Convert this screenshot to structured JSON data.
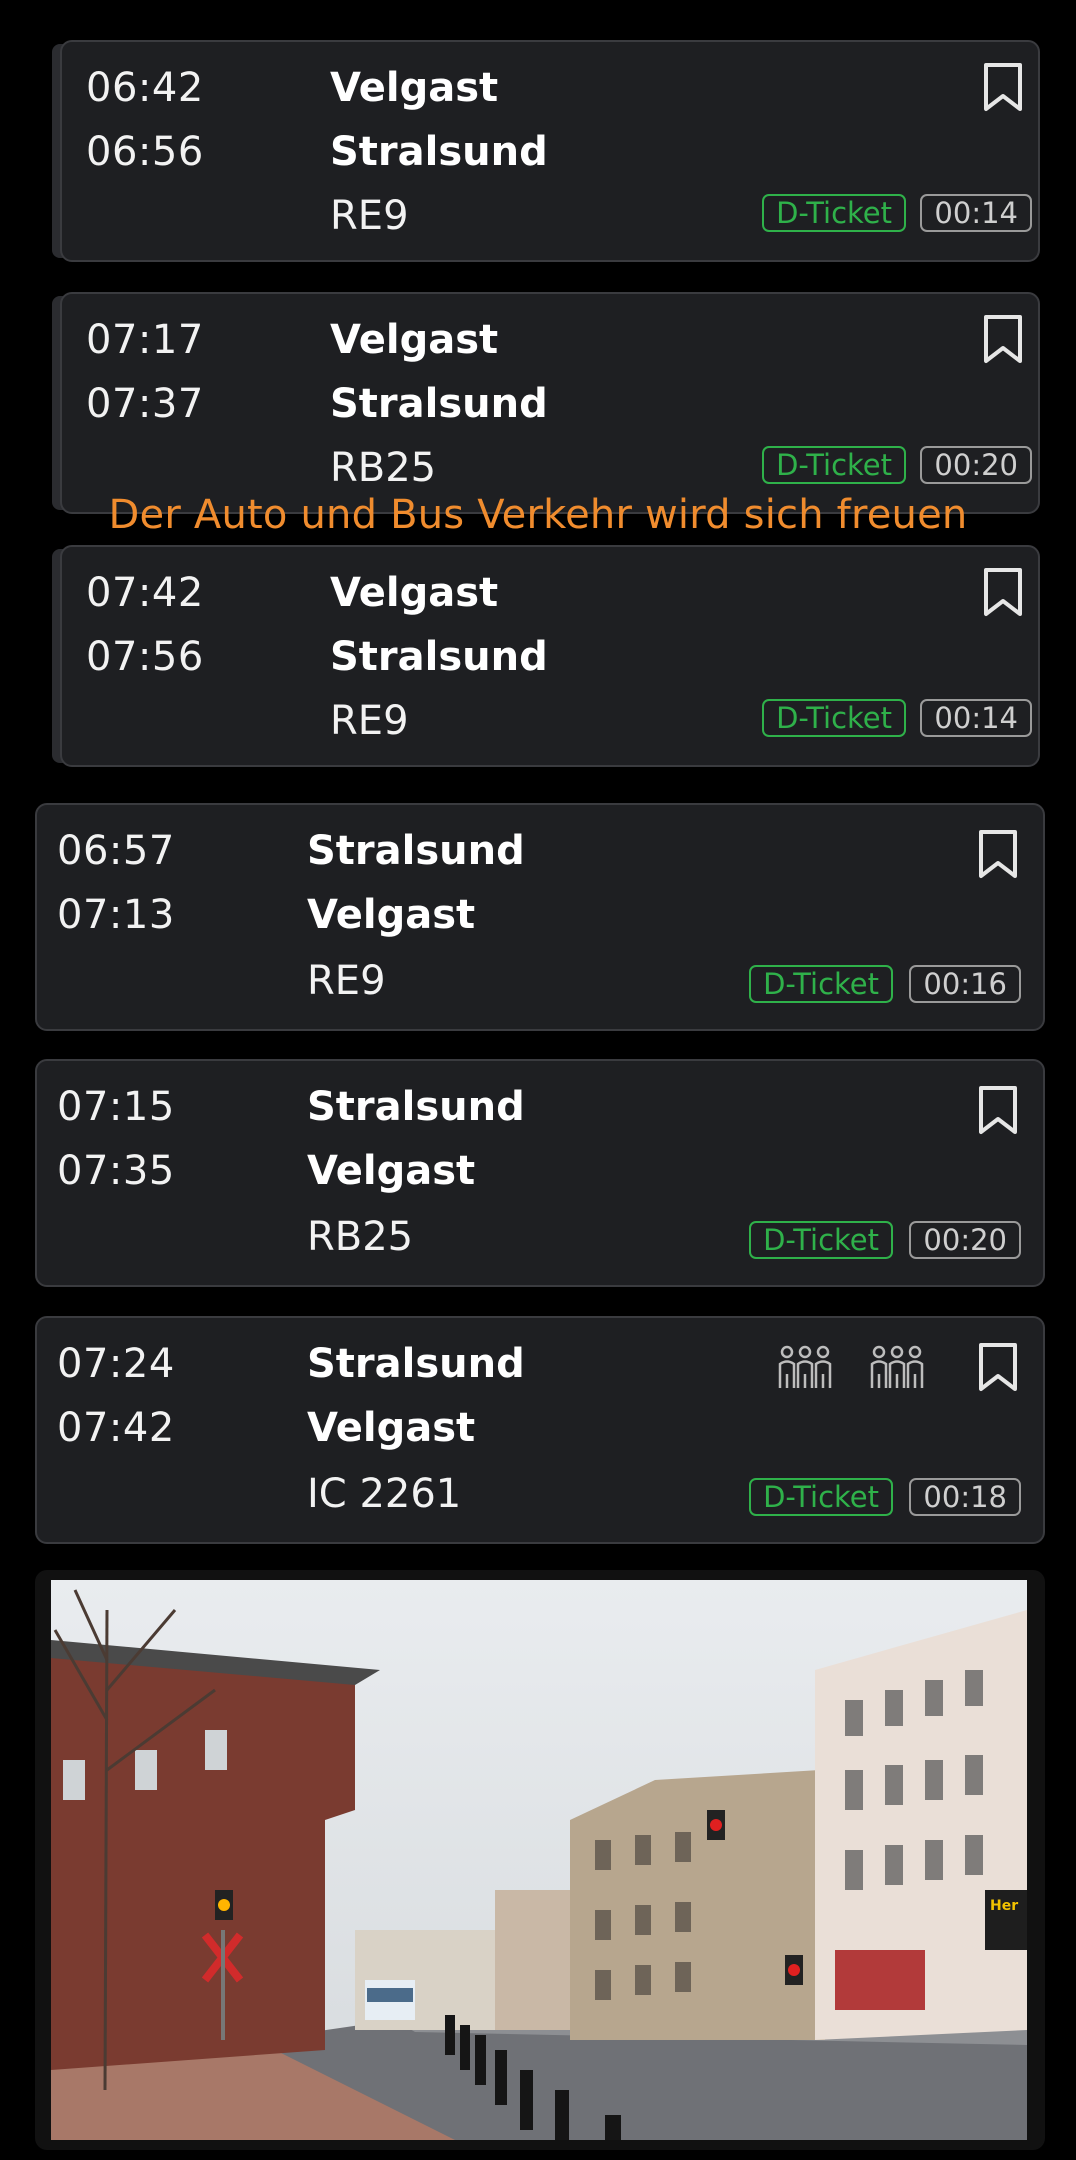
{
  "caption": "Der Auto und Bus Verkehr wird sich freuen",
  "connections": [
    {
      "dep": "06:42",
      "arr": "06:56",
      "from": "Velgast",
      "to": "Stralsund",
      "line": "RE9",
      "ticket": "D-Ticket",
      "duration": "00:14"
    },
    {
      "dep": "07:17",
      "arr": "07:37",
      "from": "Velgast",
      "to": "Stralsund",
      "line": "RB25",
      "ticket": "D-Ticket",
      "duration": "00:20"
    },
    {
      "dep": "07:42",
      "arr": "07:56",
      "from": "Velgast",
      "to": "Stralsund",
      "line": "RE9",
      "ticket": "D-Ticket",
      "duration": "00:14"
    },
    {
      "dep": "06:57",
      "arr": "07:13",
      "from": "Stralsund",
      "to": "Velgast",
      "line": "RE9",
      "ticket": "D-Ticket",
      "duration": "00:16"
    },
    {
      "dep": "07:15",
      "arr": "07:35",
      "from": "Stralsund",
      "to": "Velgast",
      "line": "RB25",
      "ticket": "D-Ticket",
      "duration": "00:20"
    },
    {
      "dep": "07:24",
      "arr": "07:42",
      "from": "Stralsund",
      "to": "Velgast",
      "line": "IC 2261",
      "ticket": "D-Ticket",
      "duration": "00:18",
      "occupancy_icons": [
        "crowd-icon",
        "crowd-icon"
      ]
    }
  ],
  "photo": {
    "description_icon": "street-photo",
    "sign_text": "Her"
  }
}
